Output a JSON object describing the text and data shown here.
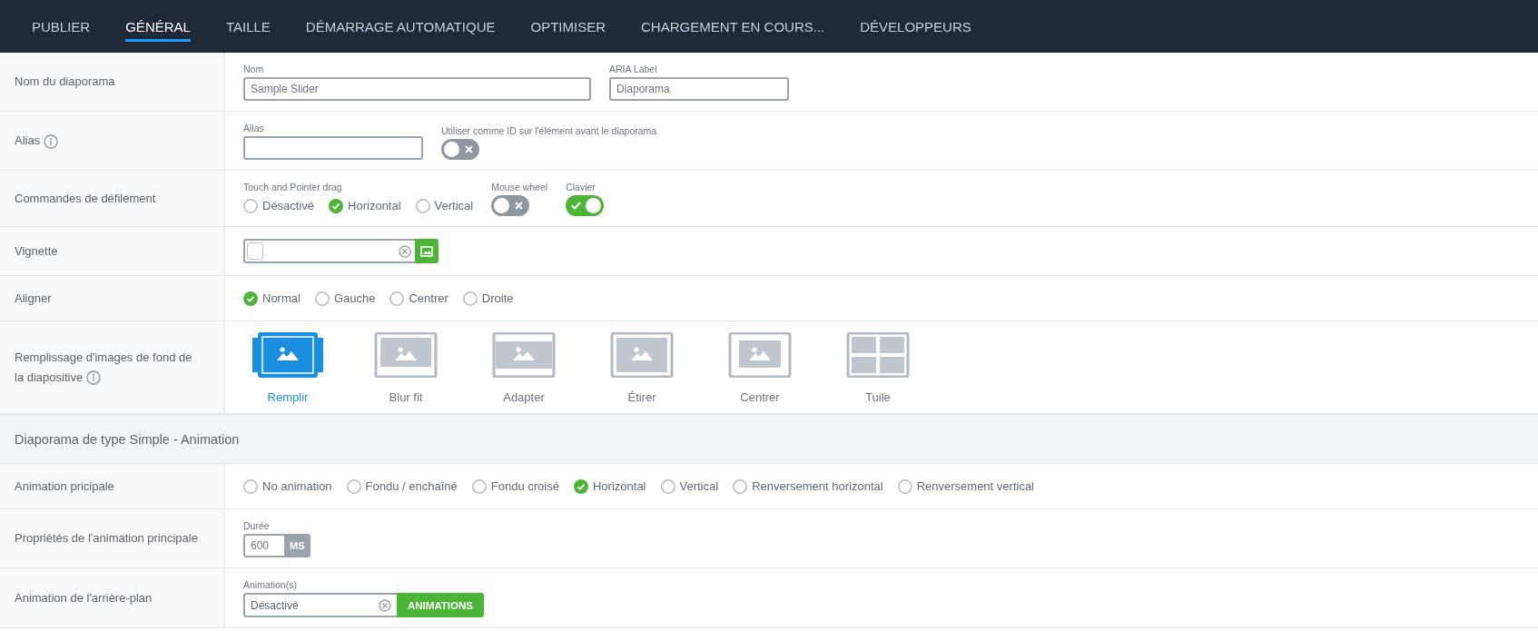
{
  "tabs": [
    {
      "label": "PUBLIER",
      "selected": false
    },
    {
      "label": "GÉNÉRAL",
      "selected": true
    },
    {
      "label": "TAILLE",
      "selected": false
    },
    {
      "label": "DÉMARRAGE AUTOMATIQUE",
      "selected": false
    },
    {
      "label": "OPTIMISER",
      "selected": false
    },
    {
      "label": "CHARGEMENT EN COURS...",
      "selected": false
    },
    {
      "label": "DÉVELOPPEURS",
      "selected": false
    }
  ],
  "rows": [
    {
      "kind": "row",
      "label": "Nom du diaporama",
      "info": false,
      "controls": [
        {
          "kind": "text",
          "caption": "Nom",
          "value": "Sample Slider"
        },
        {
          "kind": "text",
          "caption": "ARIA Label",
          "value": "Diaporama"
        }
      ]
    },
    {
      "kind": "row",
      "label": "Alias",
      "info": true,
      "controls": [
        {
          "kind": "text",
          "caption": "Alias"
        },
        {
          "kind": "toggle",
          "caption": "Utiliser comme ID sur l'élément avant le diaporama",
          "on": false
        }
      ]
    },
    {
      "kind": "row",
      "label": "Commandes de défilement",
      "info": false,
      "controls": [
        {
          "kind": "radios",
          "caption": "Touch and Pointer drag",
          "options": [
            {
              "label": "Désactivé",
              "selected": false
            },
            {
              "label": "Horizontal",
              "selected": true
            },
            {
              "label": "Vertical",
              "selected": false
            }
          ]
        },
        {
          "kind": "toggle",
          "caption": "Mouse wheel",
          "on": false
        },
        {
          "kind": "toggle",
          "caption": "Clavier",
          "on": true
        }
      ]
    },
    {
      "kind": "row",
      "label": "Vignette",
      "info": false,
      "controls": [
        {
          "kind": "image_picker"
        }
      ]
    },
    {
      "kind": "row",
      "label": "Aligner",
      "info": false,
      "controls": [
        {
          "kind": "radios",
          "options": [
            {
              "label": "Normal",
              "selected": true
            },
            {
              "label": "Gauche",
              "selected": false
            },
            {
              "label": "Centrer",
              "selected": false
            },
            {
              "label": "Droite",
              "selected": false
            }
          ]
        }
      ]
    },
    {
      "kind": "row",
      "label": "Remplissage d'images de fond de la diapositive",
      "info": true,
      "controls": [
        {
          "kind": "fill_options",
          "options": [
            {
              "label": "Remplir",
              "selected": true
            },
            {
              "label": "Blur fit",
              "selected": false
            },
            {
              "label": "Adapter",
              "selected": false
            },
            {
              "label": "Étirer",
              "selected": false
            },
            {
              "label": "Centrer",
              "selected": false
            },
            {
              "label": "Tuile",
              "selected": false
            }
          ]
        }
      ]
    },
    {
      "kind": "section",
      "label": "Diaporama de type Simple - Animation"
    },
    {
      "kind": "row",
      "label": "Animation pricipale",
      "info": false,
      "controls": [
        {
          "kind": "radios",
          "options": [
            {
              "label": "No animation",
              "selected": false
            },
            {
              "label": "Fondu / enchaîné",
              "selected": false
            },
            {
              "label": "Fondu croisé",
              "selected": false
            },
            {
              "label": "Horizontal",
              "selected": true
            },
            {
              "label": "Vertical",
              "selected": false
            },
            {
              "label": "Renversement horizontal",
              "selected": false
            },
            {
              "label": "Renversement vertical",
              "selected": false
            }
          ]
        }
      ]
    },
    {
      "kind": "row",
      "label": "Propriétés de l'animation principale",
      "info": false,
      "controls": [
        {
          "kind": "unit_field",
          "caption": "Durée",
          "value": "600",
          "unit": "MS"
        }
      ]
    },
    {
      "kind": "row",
      "label": "Animation de l'arrière-plan",
      "info": false,
      "controls": [
        {
          "kind": "picker",
          "caption": "Animation(s)",
          "value": "Désactivé",
          "button": "ANIMATIONS"
        }
      ]
    }
  ]
}
